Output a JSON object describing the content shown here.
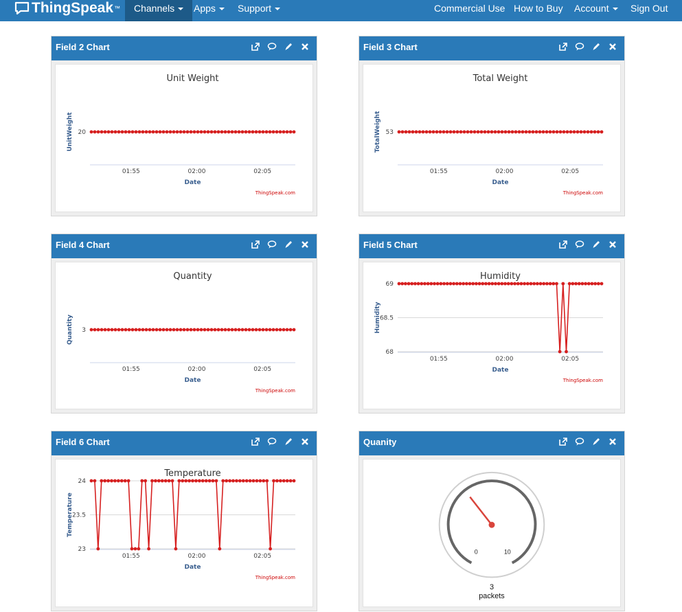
{
  "nav": {
    "brand": "ThingSpeak",
    "brand_mark": "™",
    "items": [
      {
        "label": "Channels",
        "has_caret": true,
        "active": true
      },
      {
        "label": "Apps",
        "has_caret": true,
        "active": false
      },
      {
        "label": "Support",
        "has_caret": true,
        "active": false
      },
      {
        "label": "Commercial Use",
        "has_caret": false,
        "active": false
      },
      {
        "label": "How to Buy",
        "has_caret": false,
        "active": false
      },
      {
        "label": "Account",
        "has_caret": true,
        "active": false
      },
      {
        "label": "Sign Out",
        "has_caret": false,
        "active": false
      }
    ]
  },
  "panels": [
    {
      "title": "Field 2 Chart"
    },
    {
      "title": "Field 3 Chart"
    },
    {
      "title": "Field 4 Chart"
    },
    {
      "title": "Field 5 Chart"
    },
    {
      "title": "Field 6 Chart"
    },
    {
      "title": "Quanity"
    }
  ],
  "tool_icons": [
    "external-link-icon",
    "comment-icon",
    "pencil-icon",
    "close-icon"
  ],
  "colors": {
    "nav_bg": "#2a7ab8",
    "nav_active_bg": "#1d5a88",
    "series": "#d62020",
    "axis_label": "#3a5f8f",
    "credit": "#cc0000",
    "gauge_needle": "#d9453c"
  },
  "credit_text": "ThingSpeak.com",
  "chart_data": [
    {
      "type": "line",
      "title": "Unit Weight",
      "xlabel": "Date",
      "ylabel": "UnitWeight",
      "x_ticks": [
        "01:55",
        "02:00",
        "02:05"
      ],
      "y_ticks": [
        "20"
      ],
      "ylim": [
        19,
        21
      ],
      "series": [
        {
          "values": [
            20,
            20,
            20,
            20,
            20,
            20,
            20,
            20,
            20,
            20,
            20,
            20,
            20,
            20,
            20,
            20,
            20,
            20,
            20,
            20,
            20,
            20,
            20,
            20,
            20,
            20,
            20,
            20,
            20,
            20,
            20,
            20,
            20,
            20,
            20,
            20,
            20,
            20,
            20,
            20,
            20,
            20,
            20,
            20,
            20,
            20,
            20,
            20,
            20,
            20,
            20,
            20,
            20,
            20,
            20,
            20,
            20,
            20,
            20,
            20
          ]
        }
      ]
    },
    {
      "type": "line",
      "title": "Total Weight",
      "xlabel": "Date",
      "ylabel": "TotalWeight",
      "x_ticks": [
        "01:55",
        "02:00",
        "02:05"
      ],
      "y_ticks": [
        "53"
      ],
      "ylim": [
        52,
        54
      ],
      "series": [
        {
          "values": [
            53,
            53,
            53,
            53,
            53,
            53,
            53,
            53,
            53,
            53,
            53,
            53,
            53,
            53,
            53,
            53,
            53,
            53,
            53,
            53,
            53,
            53,
            53,
            53,
            53,
            53,
            53,
            53,
            53,
            53,
            53,
            53,
            53,
            53,
            53,
            53,
            53,
            53,
            53,
            53,
            53,
            53,
            53,
            53,
            53,
            53,
            53,
            53,
            53,
            53,
            53,
            53,
            53,
            53,
            53,
            53,
            53,
            53,
            53,
            53
          ]
        }
      ]
    },
    {
      "type": "line",
      "title": "Quantity",
      "xlabel": "Date",
      "ylabel": "Quantity",
      "x_ticks": [
        "01:55",
        "02:00",
        "02:05"
      ],
      "y_ticks": [
        "3"
      ],
      "ylim": [
        2,
        4
      ],
      "series": [
        {
          "values": [
            3,
            3,
            3,
            3,
            3,
            3,
            3,
            3,
            3,
            3,
            3,
            3,
            3,
            3,
            3,
            3,
            3,
            3,
            3,
            3,
            3,
            3,
            3,
            3,
            3,
            3,
            3,
            3,
            3,
            3,
            3,
            3,
            3,
            3,
            3,
            3,
            3,
            3,
            3,
            3,
            3,
            3,
            3,
            3,
            3,
            3,
            3,
            3,
            3,
            3,
            3,
            3,
            3,
            3,
            3,
            3,
            3,
            3,
            3,
            3
          ]
        }
      ]
    },
    {
      "type": "line",
      "title": "Humidity",
      "xlabel": "Date",
      "ylabel": "Humidity",
      "x_ticks": [
        "01:55",
        "02:00",
        "02:05"
      ],
      "y_ticks": [
        "68",
        "68.5",
        "69"
      ],
      "ylim": [
        68,
        69
      ],
      "series": [
        {
          "values": [
            69,
            69,
            69,
            69,
            69,
            69,
            69,
            69,
            69,
            69,
            69,
            69,
            69,
            69,
            69,
            69,
            69,
            69,
            69,
            69,
            69,
            69,
            69,
            69,
            69,
            69,
            69,
            69,
            69,
            69,
            69,
            69,
            69,
            69,
            69,
            69,
            69,
            69,
            69,
            69,
            69,
            69,
            69,
            69,
            69,
            69,
            69,
            69,
            69,
            69,
            68,
            69,
            68,
            69,
            69,
            69,
            69,
            69,
            69,
            69,
            69,
            69,
            69,
            69
          ]
        }
      ]
    },
    {
      "type": "line",
      "title": "Temperature",
      "xlabel": "Date",
      "ylabel": "Temperature",
      "x_ticks": [
        "01:55",
        "02:00",
        "02:05"
      ],
      "y_ticks": [
        "23",
        "23.5",
        "24"
      ],
      "ylim": [
        23,
        24
      ],
      "series": [
        {
          "values": [
            24,
            24,
            23,
            24,
            24,
            24,
            24,
            24,
            24,
            24,
            24,
            24,
            23,
            23,
            23,
            24,
            24,
            23,
            24,
            24,
            24,
            24,
            24,
            24,
            24,
            23,
            24,
            24,
            24,
            24,
            24,
            24,
            24,
            24,
            24,
            24,
            24,
            24,
            23,
            24,
            24,
            24,
            24,
            24,
            24,
            24,
            24,
            24,
            24,
            24,
            24,
            24,
            24,
            23,
            24,
            24,
            24,
            24,
            24,
            24,
            24
          ]
        }
      ]
    }
  ],
  "gauge": {
    "value": "3",
    "units": "packets",
    "min": "0",
    "max": "10"
  }
}
